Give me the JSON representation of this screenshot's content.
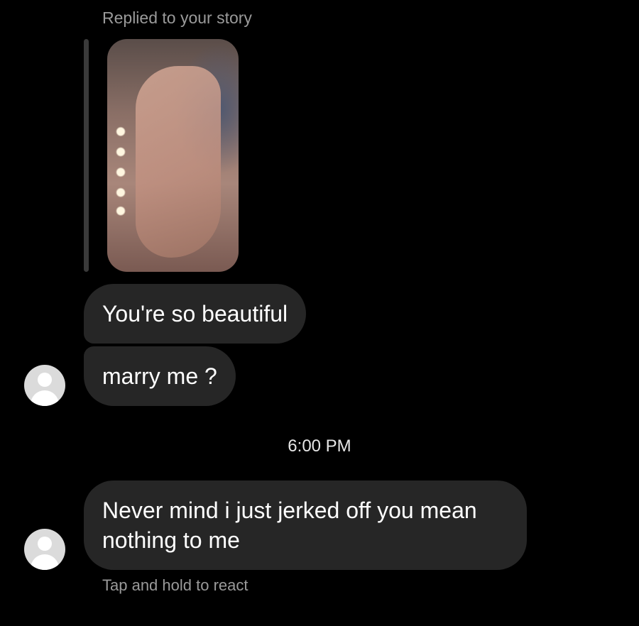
{
  "reply": {
    "caption": "Replied to your story"
  },
  "messages": [
    {
      "text": "You're so beautiful"
    },
    {
      "text": "marry me ?"
    },
    {
      "text": "Never mind i just jerked off you mean nothing to me"
    }
  ],
  "timestamp": "6:00 PM",
  "hint": "Tap and hold to react",
  "icons": {
    "avatar": "default-profile-avatar-icon"
  },
  "colors": {
    "background": "#000000",
    "bubble": "#262626",
    "secondary_text": "#9a9a9a",
    "avatar": "#dbdbdb"
  }
}
